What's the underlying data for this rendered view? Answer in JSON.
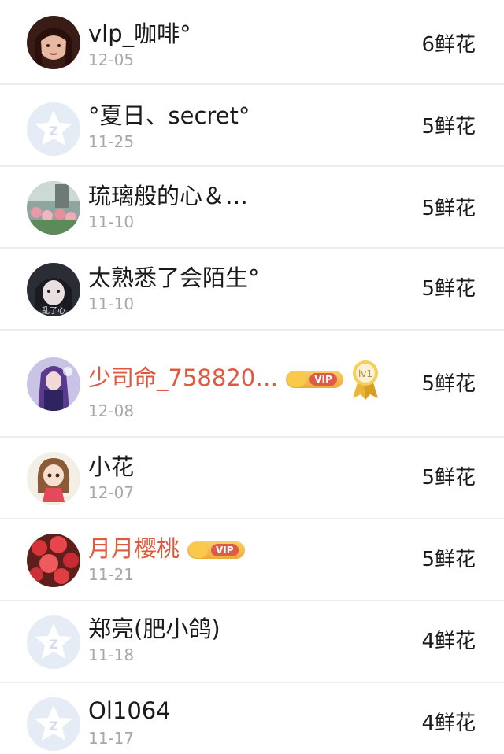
{
  "items": [
    {
      "name": "vlp_咖啡°",
      "date": "12-05",
      "flowers": "6鲜花",
      "avatar": "girl-portrait-avatar"
    },
    {
      "name": "°夏日、secret°",
      "date": "11-25",
      "flowers": "5鲜花",
      "avatar": "default-z-avatar"
    },
    {
      "name": "琉璃般的心＆…",
      "date": "11-10",
      "flowers": "5鲜花",
      "avatar": "tulip-field-avatar"
    },
    {
      "name": "太熟悉了会陌生°",
      "date": "11-10",
      "flowers": "5鲜花",
      "avatar": "girl-face-avatar",
      "avatar_text": "乱了心"
    },
    {
      "name": "少司命_758820…",
      "date": "12-08",
      "flowers": "5鲜花",
      "avatar": "anime-girl-avatar",
      "vip": true,
      "vip_label": "VIP",
      "level": "lv1"
    },
    {
      "name": "小花",
      "date": "12-07",
      "flowers": "5鲜花",
      "avatar": "cartoon-girl-avatar"
    },
    {
      "name": "月月樱桃",
      "date": "11-21",
      "flowers": "5鲜花",
      "avatar": "red-flowers-avatar",
      "vip": true,
      "vip_label": "VIP"
    },
    {
      "name": "郑亮(肥小鸽)",
      "date": "11-18",
      "flowers": "4鲜花",
      "avatar": "default-z-avatar"
    },
    {
      "name": "Ol1064",
      "date": "11-17",
      "flowers": "4鲜花",
      "avatar": "default-z-avatar"
    }
  ],
  "colors": {
    "vip_name": "#e0583e",
    "date": "#a8a8a8",
    "divider": "#ececec"
  }
}
